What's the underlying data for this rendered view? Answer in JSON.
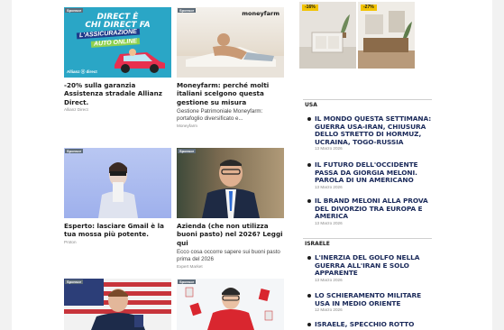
{
  "cards": [
    {
      "sponsor": "Sponsor",
      "title": "-20% sulla garanzia Assistenza stradale Allianz Direct.",
      "description": "",
      "source": "Allianz Direct",
      "ad_line1": "DIRECT È",
      "ad_line2": "CHI DIRECT FA",
      "ad_line3": "L'ASSICURAZIONE",
      "ad_line4": "AUTO ONLINE",
      "ad_logo": "Allianz ⓐ direct"
    },
    {
      "sponsor": "Sponsor",
      "title": "Moneyfarm: perché molti italiani scelgono questa gestione su misura",
      "description": "Gestione Patrimoniale Moneyfarm: portafoglio diversificato e...",
      "source": "Moneyfarm",
      "ad_logo": "moneyfarm"
    },
    {
      "sponsor": "Sponsor",
      "title": "Esperto: lasciare Gmail è la tua mossa più potente.",
      "description": "",
      "source": "Proton"
    },
    {
      "sponsor": "Sponsor",
      "title": "Azienda (che non utilizza buoni pasto) nel 2026? Leggi qui",
      "description": "Ecco cosa occorre sapere sui buoni pasto prima del 2026",
      "source": "Expert Market"
    },
    {
      "sponsor": "Sponsor"
    },
    {
      "sponsor": "Sponsor"
    }
  ],
  "side_ads": [
    {
      "discount": "-16%"
    },
    {
      "discount": "-27%"
    }
  ],
  "sections": [
    {
      "label": "USA",
      "items": [
        {
          "title": "IL MONDO QUESTA SETTIMANA: GUERRA USA-IRAN, CHIUSURA DELLO STRETTO DI HORMUZ, UCRAINA, TOGO-RUSSIA",
          "date": "13 Marzo 2026"
        },
        {
          "title": "IL FUTURO DELL'OCCIDENTE PASSA DA GIORGIA MELONI. PAROLA DI UN AMERICANO",
          "date": "13 Marzo 2026"
        },
        {
          "title": "IL BRAND MELONI ALLA PROVA DEL DIVORZIO TRA EUROPA E AMERICA",
          "date": "13 Marzo 2026"
        }
      ]
    },
    {
      "label": "ISRAELE",
      "items": [
        {
          "title": "L'INERZIA DEL GOLFO NELLA GUERRA ALL'IRAN E SOLO APPARENTE",
          "date": "13 Marzo 2026"
        },
        {
          "title": "LO SCHIERAMENTO MILITARE USA IN MEDIO ORIENTE",
          "date": "12 Marzo 2026"
        },
        {
          "title": "ISRAELE, SPECCHIO ROTTO",
          "date": ""
        }
      ]
    }
  ],
  "colors": {
    "link": "#1b2a5a",
    "sponsor_bg": "#5d6b78",
    "discount": "#f2c300"
  }
}
